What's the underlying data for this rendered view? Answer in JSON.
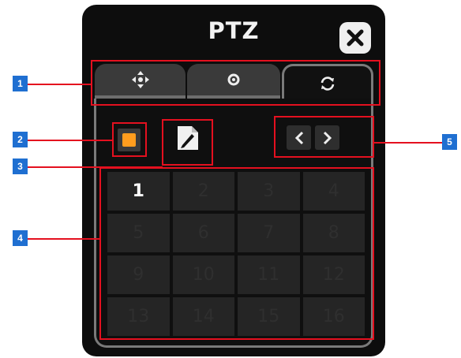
{
  "panel": {
    "title": "PTZ",
    "close_icon": "close-icon",
    "tabs": [
      {
        "icon": "move-arrows-icon",
        "active": false
      },
      {
        "icon": "focus-dot-icon",
        "active": false
      },
      {
        "icon": "refresh-cycle-icon",
        "active": true
      }
    ],
    "controls": {
      "stop_icon": "stop-icon",
      "edit_icon": "edit-document-icon",
      "prev_icon": "chevron-left-icon",
      "next_icon": "chevron-right-icon"
    },
    "grid_cells": [
      "1",
      "2",
      "3",
      "4",
      "5",
      "6",
      "7",
      "8",
      "9",
      "10",
      "11",
      "12",
      "13",
      "14",
      "15",
      "16"
    ],
    "active_cell": "1"
  },
  "annotations": {
    "labels": [
      "1",
      "2",
      "3",
      "4",
      "5"
    ],
    "callout_color": "#e4101f",
    "badge_color": "#1f6fd1"
  },
  "colors": {
    "panel_bg": "#0d0d0d",
    "accent_orange": "#ff9d1e"
  }
}
